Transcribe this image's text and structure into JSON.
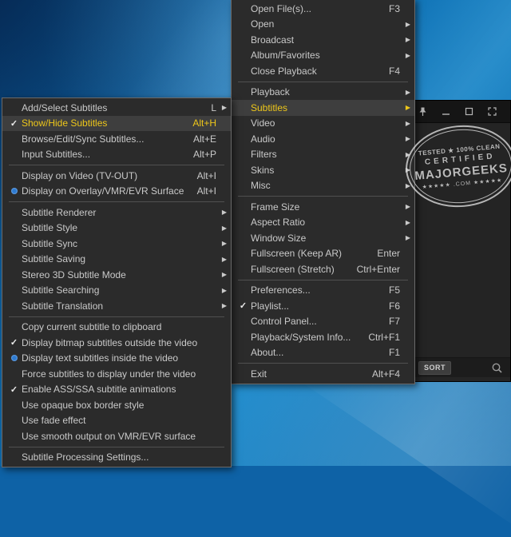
{
  "colors": {
    "accent_yellow": "#eec71a",
    "radio_blue": "#2d7ad1",
    "menu_background": "#2b2b2b",
    "desktop_blue": "#0f6bae"
  },
  "window": {
    "titlebar": {
      "icons": [
        "pin-icon",
        "minimize-icon",
        "restore-icon",
        "fullscreen-icon"
      ]
    },
    "playlist": {
      "sort_label": "SORT",
      "icons": [
        "search-icon"
      ]
    }
  },
  "stamp": {
    "line1": "TESTED ★ 100% CLEAN",
    "line2": "CERTIFIED",
    "line3": "MAJORGEEKS",
    "line4": "★★★★★ .COM ★★★★★"
  },
  "menus": {
    "main": {
      "items": [
        {
          "label": "Open File(s)...",
          "shortcut": "F3"
        },
        {
          "label": "Open",
          "submenu": true
        },
        {
          "label": "Broadcast",
          "submenu": true
        },
        {
          "label": "Album/Favorites",
          "submenu": true
        },
        {
          "label": "Close Playback",
          "shortcut": "F4"
        },
        {
          "separator": true
        },
        {
          "label": "Playback",
          "submenu": true
        },
        {
          "label": "Subtitles",
          "submenu": true,
          "highlighted": true
        },
        {
          "label": "Video",
          "submenu": true
        },
        {
          "label": "Audio",
          "submenu": true
        },
        {
          "label": "Filters",
          "submenu": true
        },
        {
          "label": "Skins",
          "submenu": true
        },
        {
          "label": "Misc",
          "submenu": true
        },
        {
          "separator": true
        },
        {
          "label": "Frame Size",
          "submenu": true
        },
        {
          "label": "Aspect Ratio",
          "submenu": true
        },
        {
          "label": "Window Size",
          "submenu": true
        },
        {
          "label": "Fullscreen (Keep AR)",
          "shortcut": "Enter"
        },
        {
          "label": "Fullscreen (Stretch)",
          "shortcut": "Ctrl+Enter"
        },
        {
          "separator": true
        },
        {
          "label": "Preferences...",
          "shortcut": "F5"
        },
        {
          "label": "Playlist...",
          "shortcut": "F6",
          "check": "check"
        },
        {
          "label": "Control Panel...",
          "shortcut": "F7"
        },
        {
          "label": "Playback/System Info...",
          "shortcut": "Ctrl+F1"
        },
        {
          "label": "About...",
          "shortcut": "F1"
        },
        {
          "separator": true
        },
        {
          "label": "Exit",
          "shortcut": "Alt+F4"
        }
      ]
    },
    "subtitles": {
      "items": [
        {
          "label": "Add/Select Subtitles",
          "shortcut": "L",
          "submenu": true
        },
        {
          "label": "Show/Hide Subtitles",
          "shortcut": "Alt+H",
          "check": "check",
          "highlighted": true
        },
        {
          "label": "Browse/Edit/Sync Subtitles...",
          "shortcut": "Alt+E"
        },
        {
          "label": "Input Subtitles...",
          "shortcut": "Alt+P"
        },
        {
          "separator": true
        },
        {
          "label": "Display on Video (TV-OUT)",
          "shortcut": "Alt+I"
        },
        {
          "label": "Display on Overlay/VMR/EVR Surface",
          "shortcut": "Alt+I",
          "check": "radio"
        },
        {
          "separator": true
        },
        {
          "label": "Subtitle Renderer",
          "submenu": true
        },
        {
          "label": "Subtitle Style",
          "submenu": true
        },
        {
          "label": "Subtitle Sync",
          "submenu": true
        },
        {
          "label": "Subtitle Saving",
          "submenu": true
        },
        {
          "label": "Stereo 3D Subtitle Mode",
          "submenu": true
        },
        {
          "label": "Subtitle Searching",
          "submenu": true
        },
        {
          "label": "Subtitle Translation",
          "submenu": true
        },
        {
          "separator": true
        },
        {
          "label": "Copy current subtitle to clipboard"
        },
        {
          "label": "Display bitmap subtitles outside the video",
          "check": "check"
        },
        {
          "label": "Display text subtitles inside the video",
          "check": "radio"
        },
        {
          "label": "Force subtitles to display under the video"
        },
        {
          "label": "Enable ASS/SSA subtitle animations",
          "check": "check"
        },
        {
          "label": "Use opaque box border style"
        },
        {
          "label": "Use fade effect"
        },
        {
          "label": "Use smooth output on VMR/EVR surface"
        },
        {
          "separator": true
        },
        {
          "label": "Subtitle Processing Settings..."
        }
      ]
    }
  }
}
